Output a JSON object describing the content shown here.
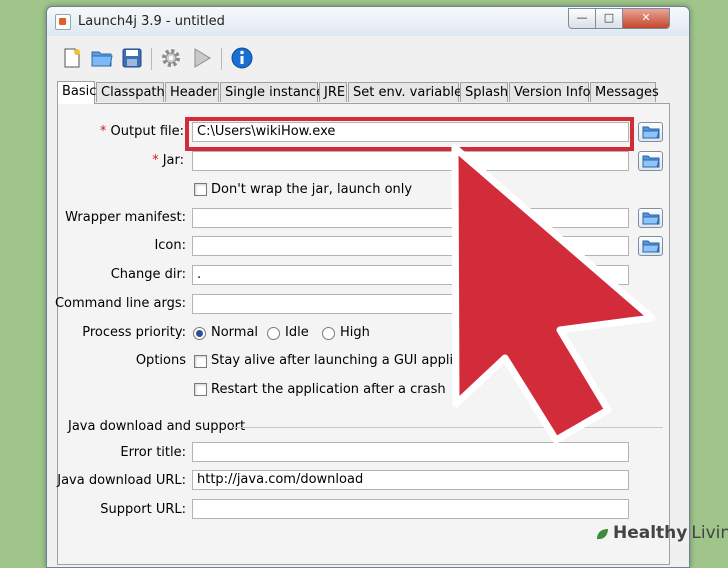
{
  "window": {
    "title": "Launch4j 3.9 - untitled",
    "controls": {
      "minimize": "—",
      "maximize": "□",
      "close": "✕"
    }
  },
  "toolbar": {
    "buttons": [
      "new-config-icon",
      "open-folder-icon",
      "save-icon",
      "gear-icon",
      "play-icon",
      "info-icon"
    ]
  },
  "tabs": [
    {
      "label": "Basic",
      "active": true
    },
    {
      "label": "Classpath"
    },
    {
      "label": "Header"
    },
    {
      "label": "Single instance"
    },
    {
      "label": "JRE"
    },
    {
      "label": "Set env. variables"
    },
    {
      "label": "Splash"
    },
    {
      "label": "Version Info"
    },
    {
      "label": "Messages"
    }
  ],
  "form": {
    "output_file": {
      "required_mark": "*",
      "label": "Output file:",
      "value": "C:\\Users\\wikiHow.exe"
    },
    "jar": {
      "required_mark": "*",
      "label": "Jar:",
      "value": ""
    },
    "dont_wrap": {
      "label": "Don't wrap the jar, launch only",
      "checked": false
    },
    "wrapper_manifest": {
      "label": "Wrapper manifest:",
      "value": ""
    },
    "icon": {
      "label": "Icon:",
      "value": ""
    },
    "change_dir": {
      "label": "Change dir:",
      "value": "."
    },
    "command_line_args": {
      "label": "Command line args:",
      "value": ""
    },
    "process_priority": {
      "label": "Process priority:",
      "options": [
        "Normal",
        "Idle",
        "High"
      ],
      "selected": "Normal"
    },
    "options": {
      "label": "Options",
      "stay_alive": {
        "label": "Stay alive after launching a GUI application",
        "checked": false
      },
      "restart": {
        "label": "Restart the application after a crash",
        "checked": false
      }
    },
    "java_download": {
      "section_title": "Java download and support",
      "error_title": {
        "label": "Error title:",
        "value": ""
      },
      "download_url": {
        "label": "Java download URL:",
        "value": "http://java.com/download"
      },
      "support_url": {
        "label": "Support URL:",
        "value": ""
      }
    }
  },
  "overlay": {
    "highlight_color": "#d22c3b",
    "arrow_color": "#d22c3b"
  },
  "watermark": {
    "brand": "Healthy",
    "brand2": "Living"
  }
}
